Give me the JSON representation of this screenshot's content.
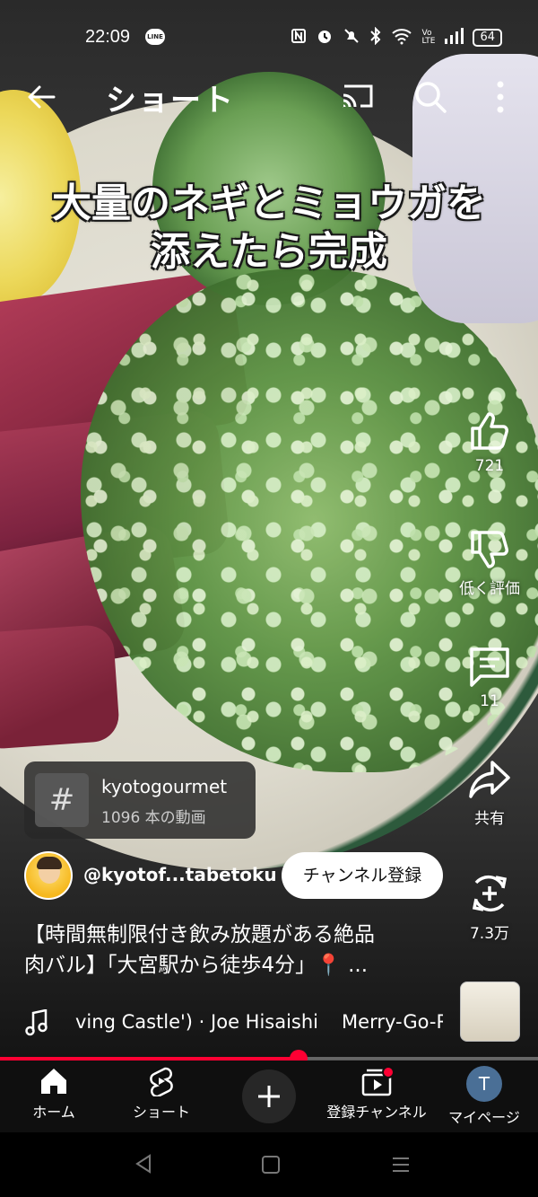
{
  "status_bar": {
    "time": "22:09",
    "line_badge": "LINE",
    "battery": "64"
  },
  "top_bar": {
    "title": "ショート"
  },
  "caption": {
    "line1": "大量のネギとミョウガを",
    "line2": "添えたら完成"
  },
  "actions": {
    "like_count": "721",
    "dislike_label": "低く評価",
    "comment_count": "11",
    "share_label": "共有",
    "remix_count": "7.3万"
  },
  "hashtag": {
    "symbol": "#",
    "name": "kyotogourmet",
    "count": "1096 本の動画"
  },
  "channel": {
    "handle": "@kyotof...tabetoku",
    "subscribe_label": "チャンネル登録"
  },
  "description": {
    "line1": "【時間無制限付き飲み放題がある絶品",
    "line2": "肉バル】「大宮駅から徒歩4分」📍 ..."
  },
  "music": {
    "track_part1": "ving Castle') · Joe Hisaishi",
    "track_part2": "Merry-Go-Ro"
  },
  "progress": {
    "fraction": 0.555
  },
  "bottom_nav": {
    "home_label": "ホーム",
    "shorts_label": "ショート",
    "subscriptions_label": "登録チャンネル",
    "me_label": "マイページ",
    "me_initial": "T"
  },
  "colors": {
    "accent": "#ff0033",
    "nav_bg": "#0f0f0f"
  }
}
